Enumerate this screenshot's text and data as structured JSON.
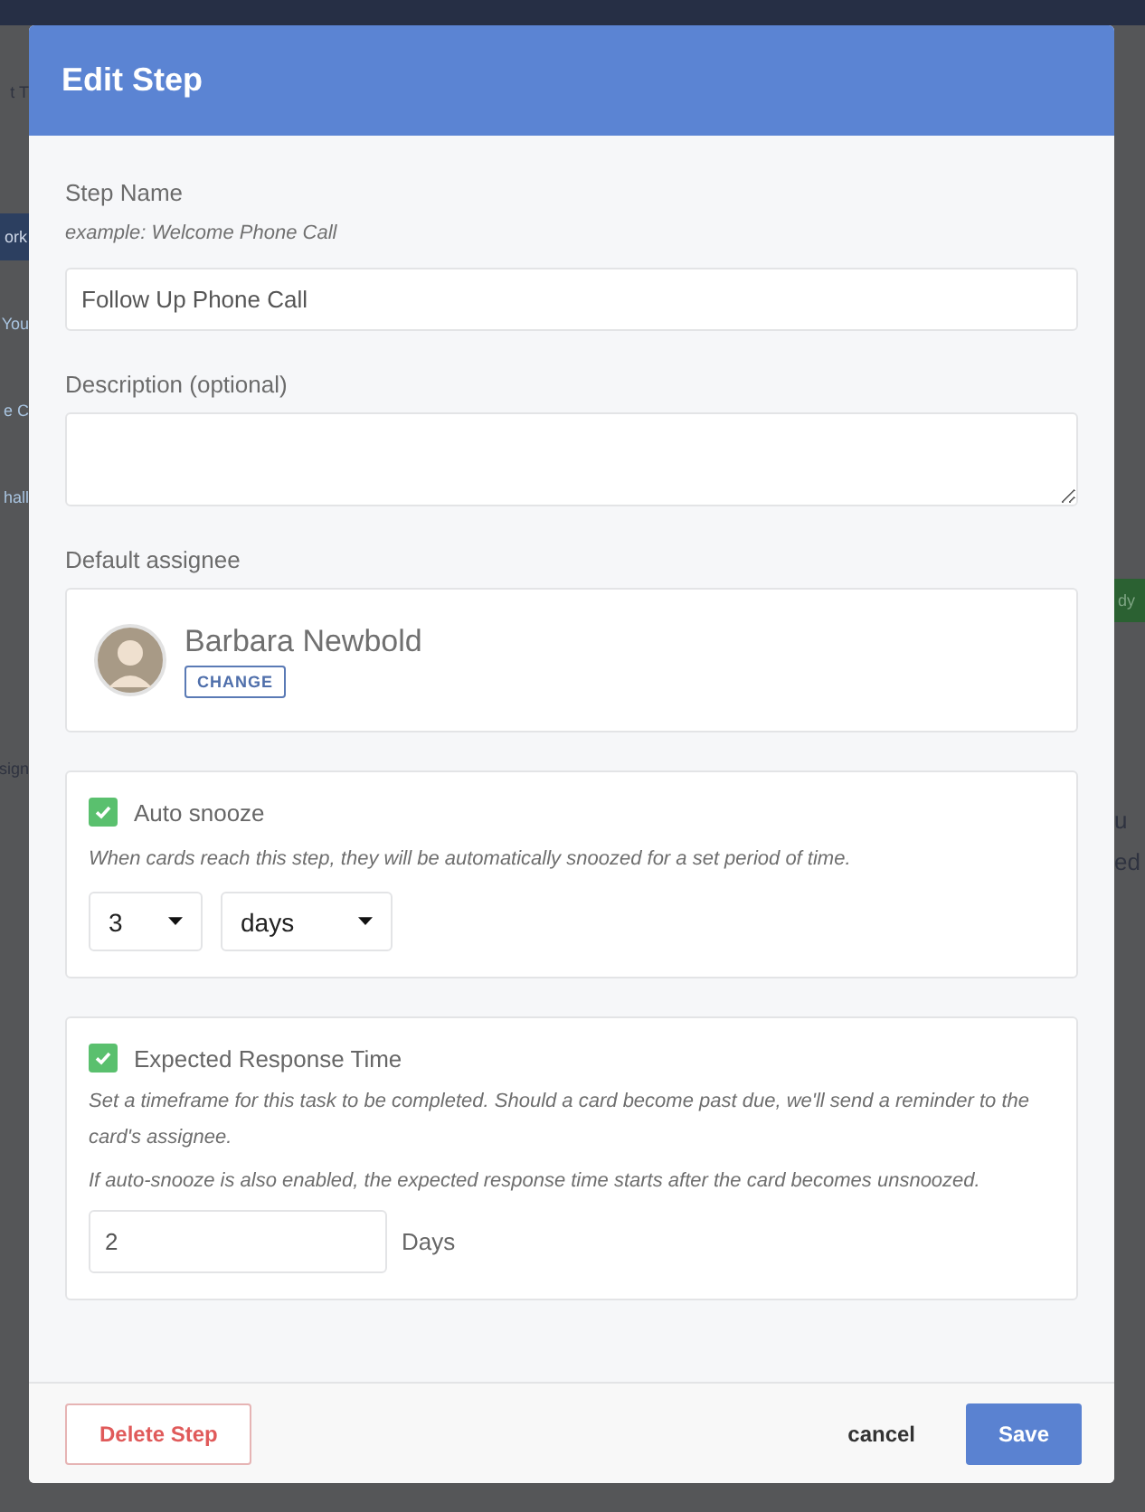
{
  "background": {
    "left_fragments": [
      {
        "text": "t T",
        "kind": "text"
      },
      {
        "text": "ork",
        "kind": "highlight"
      },
      {
        "text": "You",
        "kind": "link"
      },
      {
        "text": "e C",
        "kind": "link"
      },
      {
        "text": "hall",
        "kind": "link"
      },
      {
        "text": "sign",
        "kind": "text"
      }
    ],
    "right_fragments": [
      {
        "text": "dy",
        "kind": "badge"
      },
      {
        "text": "u",
        "kind": "text"
      },
      {
        "text": "ed",
        "kind": "text"
      }
    ]
  },
  "dialog": {
    "title": "Edit Step"
  },
  "step_name": {
    "label": "Step Name",
    "hint": "example: Welcome Phone Call",
    "value": "Follow Up Phone Call"
  },
  "description": {
    "label": "Description (optional)"
  },
  "assignee": {
    "label": "Default assignee",
    "name": "Barbara Newbold",
    "button": "CHANGE"
  },
  "auto_snooze": {
    "label": "Auto snooze",
    "checked": true,
    "note": "When cards reach this step, they will be automatically snoozed for a set period of time.",
    "amount": "3",
    "unit": "days"
  },
  "response_time": {
    "label": "Expected Response Time",
    "checked": true,
    "notes": [
      "Set a timeframe for this task to be completed. Should a card become past due, we'll send a reminder to the card's assignee.",
      "If auto-snooze is also enabled, the expected response time starts after the card becomes unsnoozed."
    ],
    "value": "2",
    "unit": "Days"
  },
  "footer": {
    "delete": "Delete Step",
    "cancel": "cancel",
    "save": "Save"
  }
}
